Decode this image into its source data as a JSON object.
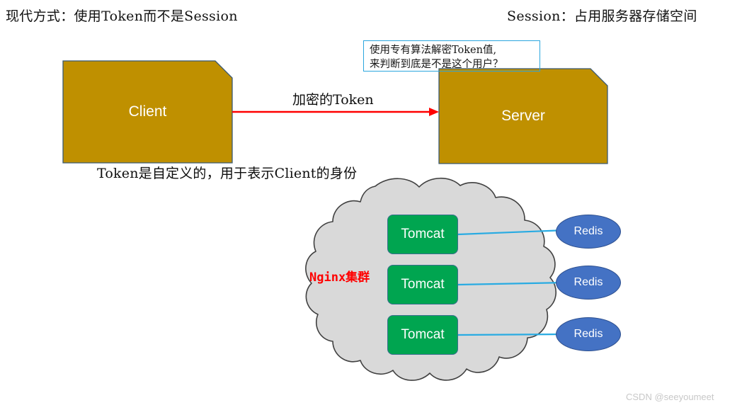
{
  "headings": {
    "left": "现代方式：使用Token而不是Session",
    "right": "Session：占用服务器存储空间"
  },
  "callout": {
    "line1": "使用专有算法解密Token值,",
    "line2": "来判断到底是不是这个用户？",
    "border_color": "#2BA6DE"
  },
  "nodes": {
    "client": {
      "label": "Client",
      "fill": "#BF9000",
      "border": "#3B5A75",
      "text_color": "#FFFFFF"
    },
    "server": {
      "label": "Server",
      "fill": "#BF9000",
      "border": "#3B5A75",
      "text_color": "#FFFFFF"
    }
  },
  "arrow": {
    "label": "加密的Token",
    "color": "#FF0000"
  },
  "captions": {
    "token": "Token是自定义的，用于表示Client的身份"
  },
  "cloud": {
    "label": "Nginx集群",
    "label_color": "#FF0000",
    "fill": "#D9D9D9",
    "border": "#404040"
  },
  "tomcats": [
    {
      "label": "Tomcat"
    },
    {
      "label": "Tomcat"
    },
    {
      "label": "Tomcat"
    }
  ],
  "redis_nodes": [
    {
      "label": "Redis"
    },
    {
      "label": "Redis"
    },
    {
      "label": "Redis"
    }
  ],
  "connector": {
    "color": "#29ABE2"
  },
  "colors": {
    "tomcat_green": "#00A550",
    "redis_blue": "#4472C4",
    "gold": "#BF9000"
  },
  "watermark": "CSDN @seeyoumeet"
}
